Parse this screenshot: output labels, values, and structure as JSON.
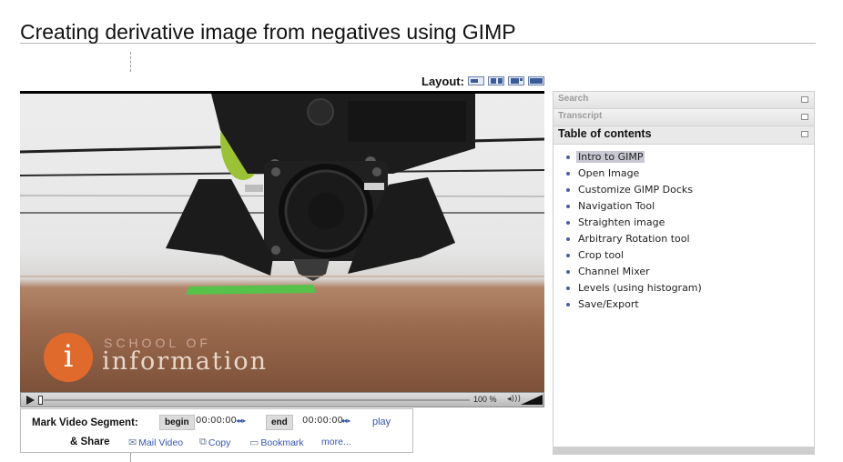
{
  "page": {
    "title": "Creating derivative image from negatives using GIMP"
  },
  "layout": {
    "label": "Layout:",
    "options": [
      "layout-icon-1",
      "layout-icon-2",
      "layout-icon-3",
      "layout-icon-4"
    ]
  },
  "video": {
    "watermark_subtitle": "School of",
    "watermark_title": "information",
    "logo_glyph": "i",
    "playback_progress": 0.0
  },
  "player": {
    "zoom_label": "100 %",
    "volume_glyph": "◂)))"
  },
  "segment": {
    "mark_label": "Mark Video Segment:",
    "begin_label": "begin",
    "begin_time": "00:00:00",
    "end_label": "end",
    "end_time": "00:00:00",
    "step_arrows": "◂◂ ▸",
    "play_label": "play",
    "share_label": "& Share",
    "mail_label": "Mail Video",
    "copy_label": "Copy",
    "bookmark_label": "Bookmark",
    "more_label": "more..."
  },
  "panel": {
    "search_label": "Search",
    "transcript_label": "Transcript",
    "toc_label": "Table of contents",
    "toc_items": [
      "Intro to GIMP",
      "Open Image",
      "Customize GIMP Docks",
      "Navigation Tool",
      "Straighten image",
      "Arbitrary Rotation tool",
      "Crop tool",
      "Channel Mixer",
      "Levels (using histogram)",
      "Save/Export"
    ],
    "active_index": 0
  },
  "colors": {
    "logo_orange": "#e06a2c",
    "link_blue": "#3454b4",
    "bed_brown": "#9b6a4e",
    "fan_gear_green": "#9bc236"
  }
}
